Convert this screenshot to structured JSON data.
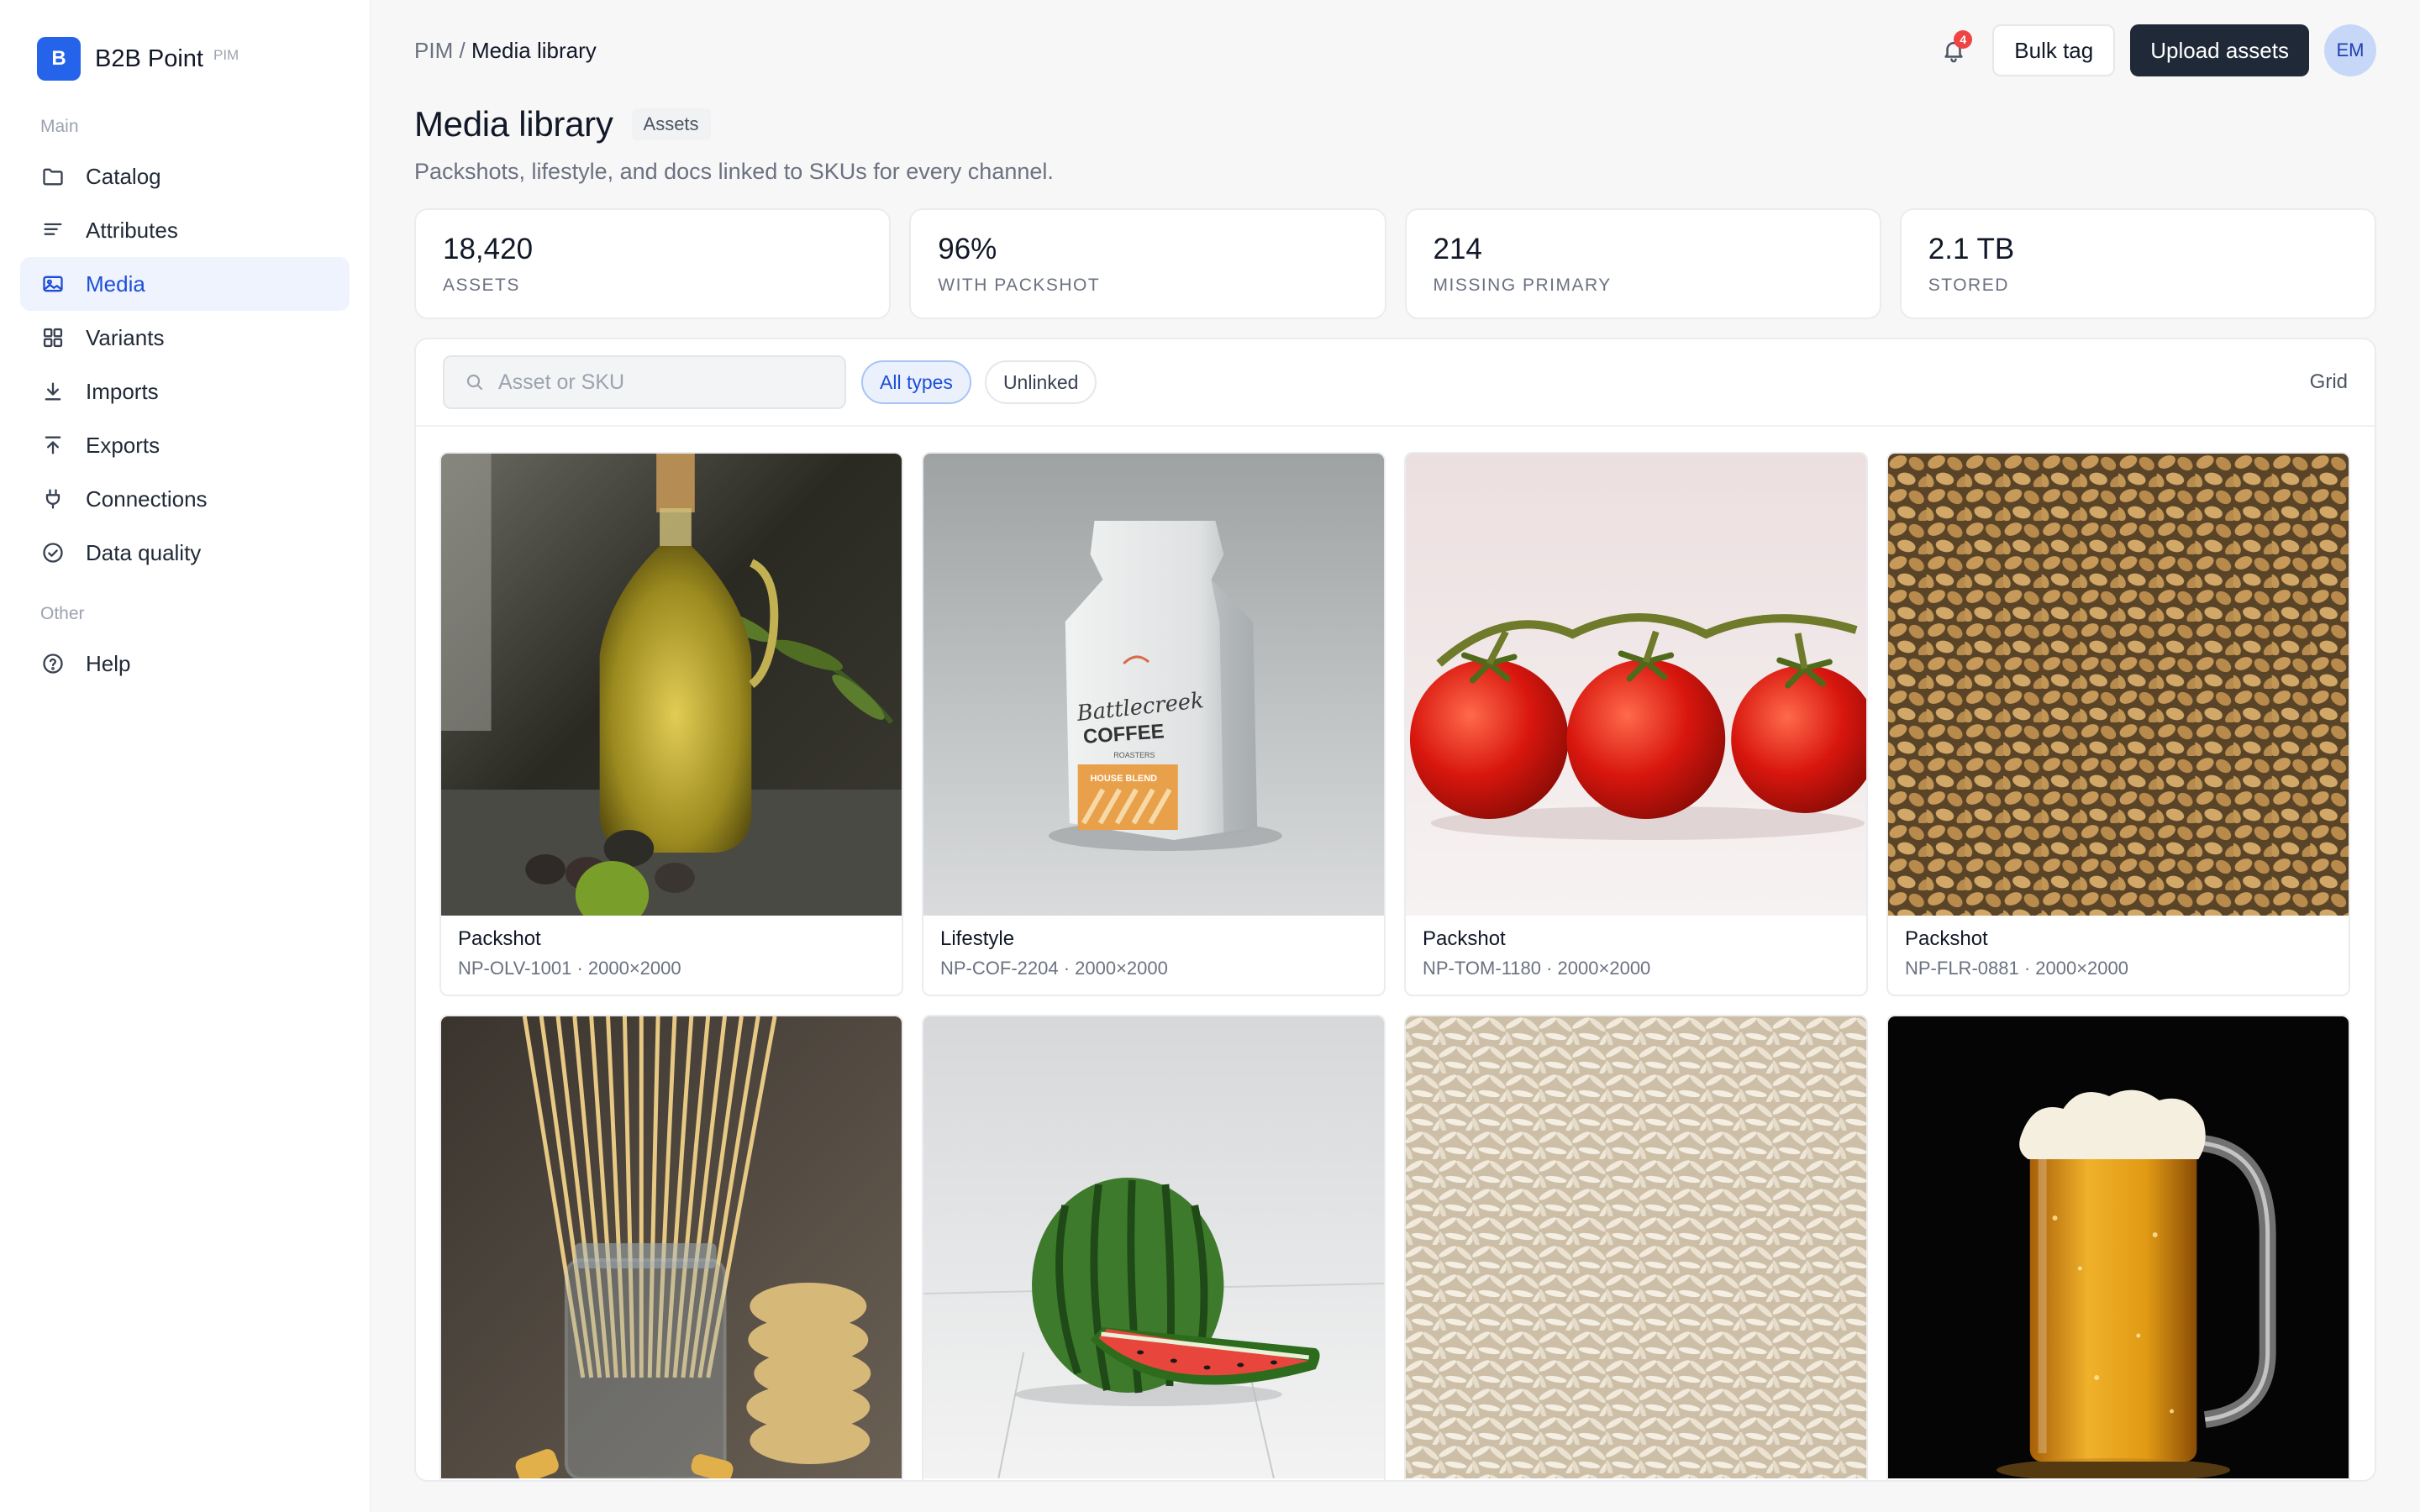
{
  "brand": {
    "logo_letter": "B",
    "name": "B2B Point",
    "tag": "PIM",
    "accent": "#2563eb"
  },
  "sidebar": {
    "section_main": "Main",
    "section_other": "Other",
    "items": [
      {
        "label": "Catalog",
        "icon": "folder-icon",
        "active": false
      },
      {
        "label": "Attributes",
        "icon": "list-icon",
        "active": false
      },
      {
        "label": "Media",
        "icon": "image-icon",
        "active": true
      },
      {
        "label": "Variants",
        "icon": "grid-icon",
        "active": false
      },
      {
        "label": "Imports",
        "icon": "download-icon",
        "active": false
      },
      {
        "label": "Exports",
        "icon": "upload-icon",
        "active": false
      },
      {
        "label": "Connections",
        "icon": "plug-icon",
        "active": false
      },
      {
        "label": "Data quality",
        "icon": "check-circle-icon",
        "active": false
      }
    ],
    "other_items": [
      {
        "label": "Help",
        "icon": "help-circle-icon",
        "active": false
      }
    ]
  },
  "topbar": {
    "breadcrumb_root": "PIM",
    "breadcrumb_sep": "/",
    "breadcrumb_current": "Media library",
    "notification_count": "4",
    "bulk_tag_label": "Bulk tag",
    "upload_label": "Upload assets",
    "avatar_initials": "EM"
  },
  "page": {
    "title": "Media library",
    "badge": "Assets",
    "subtitle": "Packshots, lifestyle, and docs linked to SKUs for every channel."
  },
  "stats": [
    {
      "value": "18,420",
      "label": "ASSETS"
    },
    {
      "value": "96%",
      "label": "WITH PACKSHOT"
    },
    {
      "value": "214",
      "label": "MISSING PRIMARY"
    },
    {
      "value": "2.1 TB",
      "label": "STORED"
    }
  ],
  "toolbar": {
    "search_placeholder": "Asset or SKU",
    "search_value": "",
    "filter_all": "All types",
    "filter_unlinked": "Unlinked",
    "view_label": "Grid"
  },
  "assets": [
    {
      "type": "Packshot",
      "meta": "NP-OLV-1001 · 2000×2000",
      "subject": "olive-oil-bottle"
    },
    {
      "type": "Lifestyle",
      "meta": "NP-COF-2204 · 2000×2000",
      "subject": "coffee-bag"
    },
    {
      "type": "Packshot",
      "meta": "NP-TOM-1180 · 2000×2000",
      "subject": "tomatoes-on-vine"
    },
    {
      "type": "Packshot",
      "meta": "NP-FLR-0881 · 2000×2000",
      "subject": "wheat-grains"
    },
    {
      "type": "",
      "meta": "",
      "subject": "pasta-jar"
    },
    {
      "type": "",
      "meta": "",
      "subject": "watermelon"
    },
    {
      "type": "",
      "meta": "",
      "subject": "rice-grains"
    },
    {
      "type": "",
      "meta": "",
      "subject": "beer-mug"
    }
  ],
  "coffee_bag_text": {
    "brand": "Battlecreek",
    "product": "COFFEE",
    "sub": "ROASTERS",
    "label": "HOUSE BLEND"
  }
}
